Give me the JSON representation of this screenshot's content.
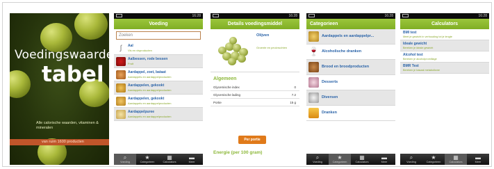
{
  "cover": {
    "title_line1": "Voedingswaarde",
    "title_line2": "tabel",
    "subtitle": "Alle calorische waarden, vitaminen & mineralen",
    "bar_text": "van ruim 1600 producten"
  },
  "status_time": "16:28",
  "voeding": {
    "title": "Voeding",
    "search_placeholder": "Zoeken",
    "items": [
      {
        "title": "Aal",
        "sub": "Vis en visproducten"
      },
      {
        "title": "Aalbessen, rode bessen",
        "sub": "Fruit"
      },
      {
        "title": "Aardappel, zoet, bataat",
        "sub": "Aardappels en aardappelproducten"
      },
      {
        "title": "Aardappelen, gekookt",
        "sub": "Aardappels en aardappelproducten"
      },
      {
        "title": "Aardappelen, gekookt",
        "sub": "Aardappels en aardappelproducten"
      },
      {
        "title": "Aardappelpuree",
        "sub": "Aardappels en aardappelproducten"
      }
    ]
  },
  "details": {
    "title": "Details voedingsmiddel",
    "name": "Olijven",
    "sub": "Groente en peulvruchten",
    "section": "Algemeen",
    "rows": [
      {
        "k": "Glycemische index",
        "v": "0"
      },
      {
        "k": "Glycemische lading",
        "v": "7.2"
      },
      {
        "k": "Portie",
        "v": "15 g"
      }
    ],
    "button": "Per portie",
    "energy": "Energie (per 100 gram)"
  },
  "categorieen": {
    "title": "Categorieen",
    "items": [
      "Aardappels en aardappelpr...",
      "Alcoholische dranken",
      "Brood en broodproducten",
      "Desserts",
      "Diversen",
      "Dranken"
    ]
  },
  "calculator": {
    "title": "Calculators",
    "items": [
      {
        "title": "BMI test",
        "sub": "Meet je gewicht in verhouding tot je lengte"
      },
      {
        "title": "Ideale gewicht",
        "sub": "Bereken je ideale gewicht"
      },
      {
        "title": "Alcohol test",
        "sub": "Bereken je alcoholpromillage"
      },
      {
        "title": "BMR Test",
        "sub": "Bereken je basaal metabolisme"
      }
    ]
  },
  "tabs": [
    "Voeding",
    "Categorieen",
    "Calculators",
    "Meer"
  ]
}
